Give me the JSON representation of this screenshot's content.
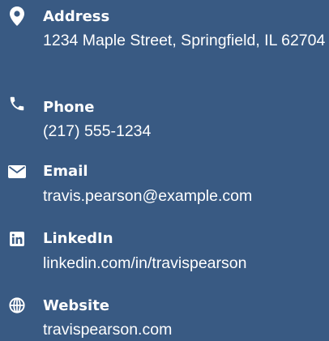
{
  "contact": {
    "address": {
      "label": "Address",
      "value": "1234 Maple Street, Springfield, IL 62704",
      "icon": "map-marker-icon"
    },
    "phone": {
      "label": "Phone",
      "value": "(217) 555-1234",
      "icon": "phone-icon"
    },
    "email": {
      "label": "Email",
      "value": "travis.pearson@example.com",
      "icon": "envelope-icon"
    },
    "linkedin": {
      "label": "LinkedIn",
      "value": "linkedin.com/in/travispearson",
      "icon": "linkedin-icon"
    },
    "website": {
      "label": "Website",
      "value": "travispearson.com",
      "icon": "globe-icon"
    }
  },
  "colors": {
    "background": "#395a83",
    "text": "#ffffff"
  }
}
